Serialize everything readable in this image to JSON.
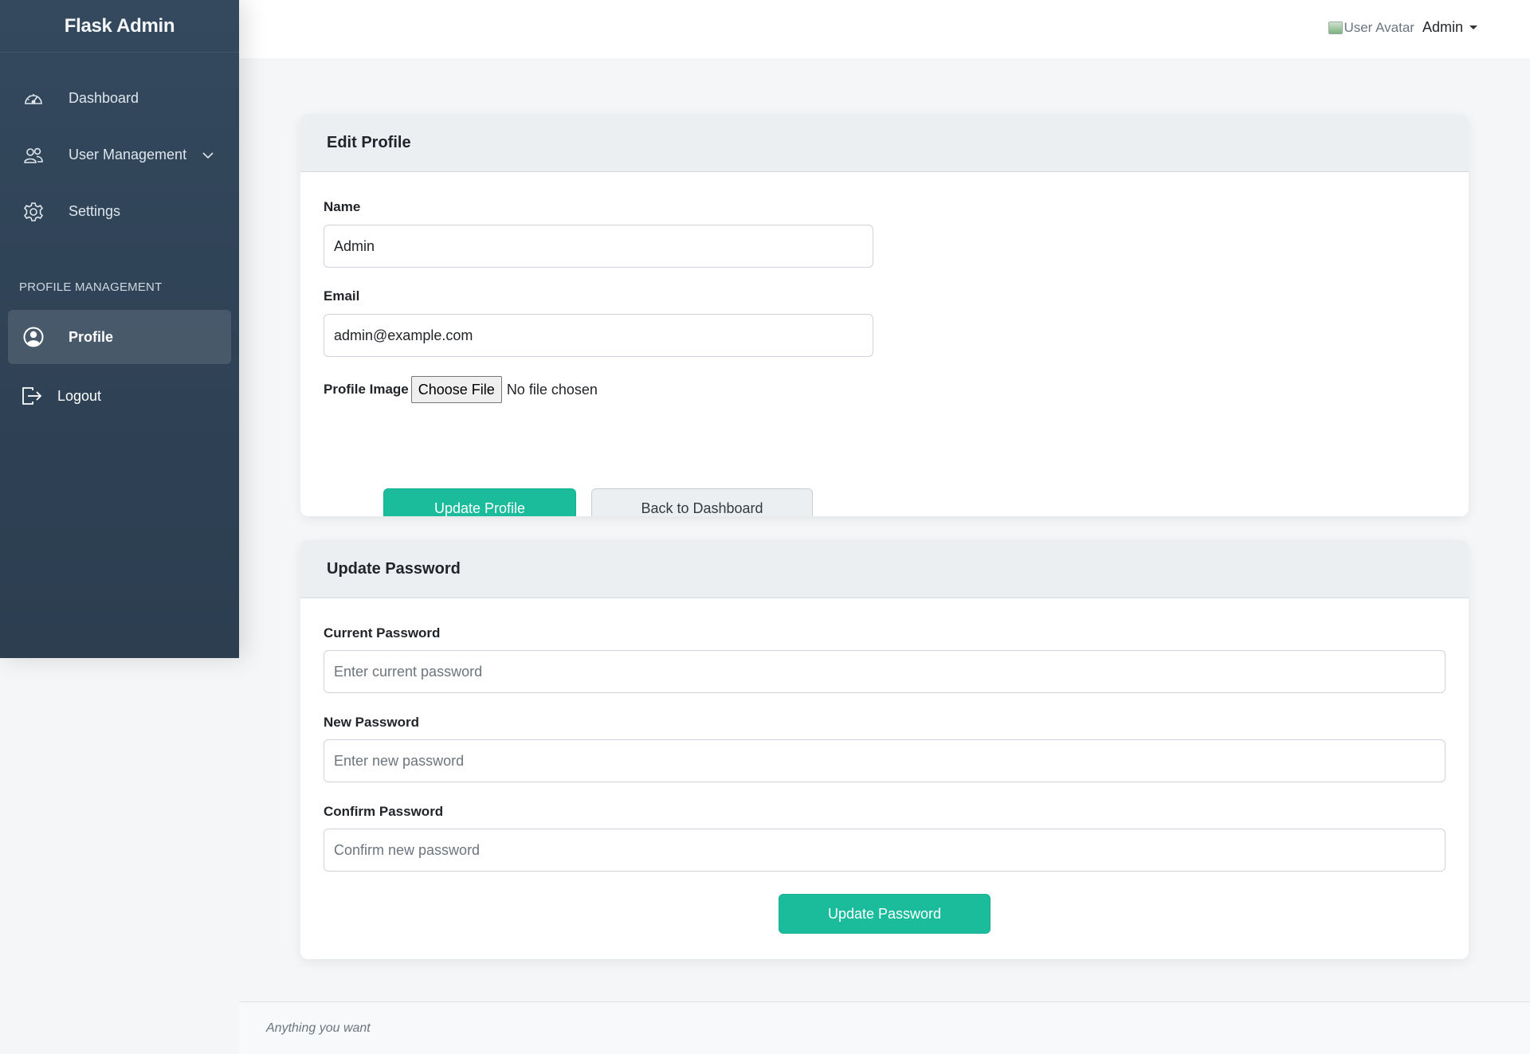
{
  "app": {
    "brand": "Flask Admin"
  },
  "sidebar": {
    "items": [
      {
        "label": "Dashboard",
        "icon": "speedometer-icon"
      },
      {
        "label": "User Management",
        "icon": "users-icon",
        "expandable": true
      },
      {
        "label": "Settings",
        "icon": "gear-icon"
      }
    ],
    "section_label": "PROFILE MANAGEMENT",
    "active_item": {
      "label": "Profile",
      "icon": "user-circle-icon"
    },
    "logout": {
      "label": "Logout",
      "icon": "logout-icon"
    }
  },
  "topbar": {
    "avatar_alt": "User Avatar",
    "username": "Admin"
  },
  "edit_profile": {
    "title": "Edit Profile",
    "name_label": "Name",
    "name_value": "Admin",
    "email_label": "Email",
    "email_value": "admin@example.com",
    "image_label": "Profile Image",
    "file_button": "Choose File",
    "file_status": "No file chosen",
    "update_button": "Update Profile",
    "back_button": "Back to Dashboard"
  },
  "update_password": {
    "title": "Update Password",
    "current_label": "Current Password",
    "current_placeholder": "Enter current password",
    "new_label": "New Password",
    "new_placeholder": "Enter new password",
    "confirm_label": "Confirm Password",
    "confirm_placeholder": "Confirm new password",
    "submit_button": "Update Password"
  },
  "footer": {
    "text": "Anything you want"
  },
  "colors": {
    "sidebar_bg": "#34495e",
    "accent": "#1abc9c",
    "card_header_bg": "#eceff1"
  }
}
